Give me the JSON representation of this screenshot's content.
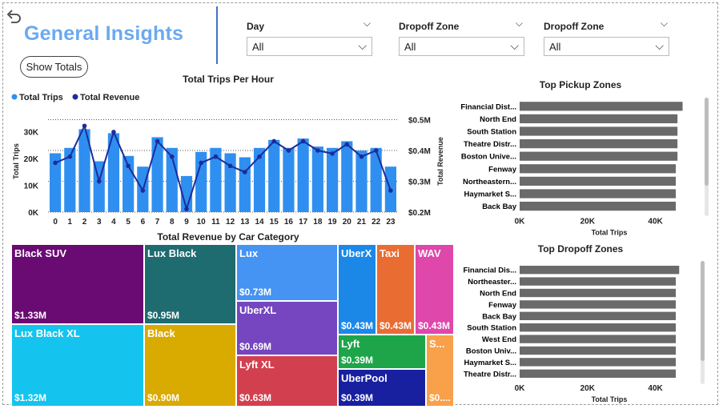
{
  "header": {
    "title": "General Insights",
    "show_totals_label": "Show Totals",
    "back_icon": "undo-arrow-icon"
  },
  "slicers": [
    {
      "label": "Day",
      "value": "All"
    },
    {
      "label": "Dropoff Zone",
      "value": "All"
    },
    {
      "label": "Dropoff Zone",
      "value": "All"
    }
  ],
  "chart_data": [
    {
      "type": "bar",
      "title": "Total Trips Per Hour",
      "legend": [
        {
          "name": "Total Trips",
          "color": "#2f8ff0"
        },
        {
          "name": "Total Revenue",
          "color": "#1c2c9c"
        }
      ],
      "legend_position": "top-left",
      "ylabel": "Total Trips",
      "y2label": "Total Revenue",
      "categories": [
        "0",
        "1",
        "2",
        "3",
        "4",
        "5",
        "6",
        "7",
        "8",
        "9",
        "10",
        "11",
        "12",
        "13",
        "14",
        "15",
        "16",
        "17",
        "18",
        "19",
        "20",
        "21",
        "22",
        "23"
      ],
      "series": [
        {
          "name": "Total Trips",
          "kind": "bar",
          "axis": "left",
          "color": "#2f8ff0",
          "values": [
            22000,
            24000,
            31000,
            19000,
            29500,
            21000,
            17000,
            28000,
            24000,
            13500,
            22500,
            24000,
            22000,
            20500,
            24000,
            27000,
            24000,
            27500,
            24500,
            24000,
            26500,
            23000,
            24000,
            17000
          ]
        },
        {
          "name": "Total Revenue",
          "kind": "line",
          "axis": "right",
          "color": "#1c2c9c",
          "values": [
            0.36,
            0.38,
            0.48,
            0.3,
            0.46,
            0.35,
            0.27,
            0.43,
            0.38,
            0.21,
            0.36,
            0.38,
            0.35,
            0.33,
            0.38,
            0.43,
            0.4,
            0.43,
            0.4,
            0.39,
            0.42,
            0.38,
            0.4,
            0.27
          ]
        }
      ],
      "ylim": [
        0,
        38000
      ],
      "yticks": [
        "0K",
        "10K",
        "20K",
        "30K"
      ],
      "ytick_values": [
        0,
        10000,
        20000,
        30000
      ],
      "y2lim": [
        0.2,
        0.53
      ],
      "y2ticks": [
        "$0.2M",
        "$0.3M",
        "$0.4M",
        "$0.5M"
      ],
      "y2tick_values": [
        0.2,
        0.3,
        0.4,
        0.5
      ],
      "grid": "dotted horizontal"
    },
    {
      "type": "treemap",
      "title": "Total Revenue by Car Category",
      "items": [
        {
          "label": "Black SUV",
          "value": "$1.33M",
          "color": "#6a0a73"
        },
        {
          "label": "Lux Black XL",
          "value": "$1.32M",
          "color": "#14c4ee"
        },
        {
          "label": "Lux Black",
          "value": "$0.95M",
          "color": "#1e6b70"
        },
        {
          "label": "Black",
          "value": "$0.90M",
          "color": "#d9aa00"
        },
        {
          "label": "Lux",
          "value": "$0.73M",
          "color": "#4593f2"
        },
        {
          "label": "UberXL",
          "value": "$0.69M",
          "color": "#7546c0"
        },
        {
          "label": "Lyft XL",
          "value": "$0.63M",
          "color": "#d2404f"
        },
        {
          "label": "UberX",
          "value": "$0.43M",
          "color": "#1b88e8"
        },
        {
          "label": "Taxi",
          "value": "$0.43M",
          "color": "#e96c33"
        },
        {
          "label": "WAV",
          "value": "$0.43M",
          "color": "#df47aa"
        },
        {
          "label": "Lyft",
          "value": "$0.39M",
          "color": "#1ea54a"
        },
        {
          "label": "UberPool",
          "value": "$0.39M",
          "color": "#1820a0"
        },
        {
          "label": "S...",
          "value": "$0....",
          "color": "#f8a04a"
        }
      ]
    },
    {
      "type": "bar",
      "orientation": "horizontal",
      "title": "Top Pickup Zones",
      "xlabel": "Total Trips",
      "categories": [
        "Financial Dist...",
        "North End",
        "South Station",
        "Theatre Distr...",
        "Boston Unive...",
        "Fenway",
        "Northeastern...",
        "Haymarket S...",
        "Back Bay"
      ],
      "values": [
        48000,
        46500,
        46500,
        46500,
        46500,
        46000,
        46000,
        46000,
        46000
      ],
      "xlim": [
        0,
        50000
      ],
      "xticks": [
        "0K",
        "20K",
        "40K"
      ],
      "xtick_values": [
        0,
        20000,
        40000
      ],
      "color": "#6a6a6a"
    },
    {
      "type": "bar",
      "orientation": "horizontal",
      "title": "Top Dropoff Zones",
      "xlabel": "Total Trips",
      "categories": [
        "Financial Dis...",
        "Northeaster...",
        "North End",
        "Fenway",
        "Back Bay",
        "South Station",
        "West End",
        "Boston Univ...",
        "Haymarket S...",
        "Theatre Distr..."
      ],
      "values": [
        47000,
        46000,
        46000,
        46000,
        46000,
        46000,
        46000,
        46000,
        46000,
        46000
      ],
      "xlim": [
        0,
        50000
      ],
      "xticks": [
        "0K",
        "20K",
        "40K"
      ],
      "xtick_values": [
        0,
        20000,
        40000
      ],
      "color": "#6a6a6a"
    }
  ]
}
